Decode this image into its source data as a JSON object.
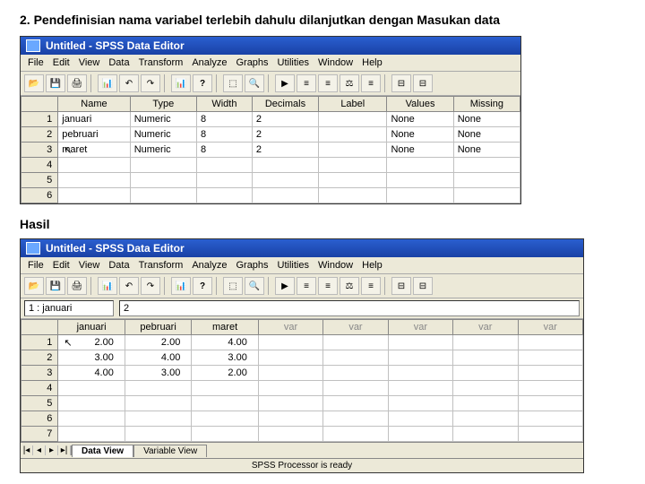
{
  "doc": {
    "heading": "2. Pendefinisian nama variabel terlebih dahulu dilanjutkan dengan Masukan data",
    "result_label": "Hasil"
  },
  "win1": {
    "title": "Untitled - SPSS Data Editor",
    "menu": [
      "File",
      "Edit",
      "View",
      "Data",
      "Transform",
      "Analyze",
      "Graphs",
      "Utilities",
      "Window",
      "Help"
    ],
    "headers": [
      "Name",
      "Type",
      "Width",
      "Decimals",
      "Label",
      "Values",
      "Missing"
    ],
    "rows": [
      {
        "n": "1",
        "name": "januari",
        "type": "Numeric",
        "width": "8",
        "dec": "2",
        "label": "",
        "values": "None",
        "missing": "None"
      },
      {
        "n": "2",
        "name": "pebruari",
        "type": "Numeric",
        "width": "8",
        "dec": "2",
        "label": "",
        "values": "None",
        "missing": "None"
      },
      {
        "n": "3",
        "name": "maret",
        "type": "Numeric",
        "width": "8",
        "dec": "2",
        "label": "",
        "values": "None",
        "missing": "None"
      }
    ],
    "empty_rows": [
      "4",
      "5",
      "6"
    ]
  },
  "win2": {
    "title": "Untitled - SPSS Data Editor",
    "menu": [
      "File",
      "Edit",
      "View",
      "Data",
      "Transform",
      "Analyze",
      "Graphs",
      "Utilities",
      "Window",
      "Help"
    ],
    "cell_addr": "1 : januari",
    "cell_val": "2",
    "headers": [
      "januari",
      "pebruari",
      "maret",
      "var",
      "var",
      "var",
      "var",
      "var"
    ],
    "rows": [
      {
        "n": "1",
        "c": [
          "2.00",
          "2.00",
          "4.00",
          "",
          "",
          "",
          "",
          ""
        ]
      },
      {
        "n": "2",
        "c": [
          "3.00",
          "4.00",
          "3.00",
          "",
          "",
          "",
          "",
          ""
        ]
      },
      {
        "n": "3",
        "c": [
          "4.00",
          "3.00",
          "2.00",
          "",
          "",
          "",
          "",
          ""
        ]
      }
    ],
    "empty_rows": [
      "4",
      "5",
      "6",
      "7"
    ],
    "tabs": {
      "data": "Data View",
      "var": "Variable View"
    },
    "status": "SPSS Processor is ready"
  }
}
